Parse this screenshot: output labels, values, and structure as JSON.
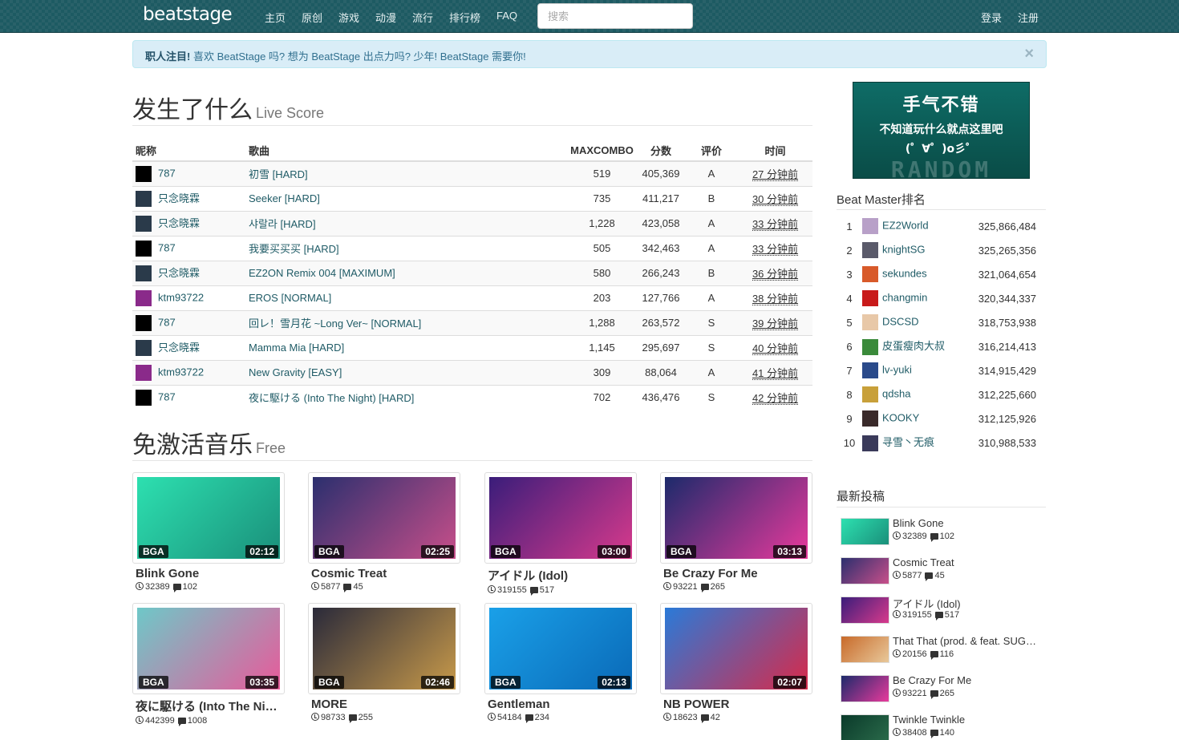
{
  "nav": {
    "brand": "beatstage",
    "links": [
      "主页",
      "原创",
      "游戏",
      "动漫",
      "流行",
      "排行榜",
      "FAQ"
    ],
    "search_placeholder": "搜索",
    "login": "登录",
    "register": "注册"
  },
  "alert": {
    "strong": "职人注目!",
    "text": "喜欢 BeatStage 吗? 想为 BeatStage 出点力吗? 少年! BeatStage 需要你!",
    "close": "×"
  },
  "live": {
    "title": "发生了什么",
    "subtitle": "Live Score",
    "headers": [
      "昵称",
      "歌曲",
      "MAXCOMBO",
      "分数",
      "评价",
      "时间"
    ],
    "rows": [
      {
        "user": "787",
        "song": "初雪 [HARD]",
        "combo": "519",
        "score": "405,369",
        "grade": "A",
        "time": "27 分钟前"
      },
      {
        "user": "只念晓霖",
        "song": "Seeker [HARD]",
        "combo": "735",
        "score": "411,217",
        "grade": "B",
        "time": "30 分钟前"
      },
      {
        "user": "只念晓霖",
        "song": "샤랄라 [HARD]",
        "combo": "1,228",
        "score": "423,058",
        "grade": "A",
        "time": "33 分钟前"
      },
      {
        "user": "787",
        "song": "我要买买买 [HARD]",
        "combo": "505",
        "score": "342,463",
        "grade": "A",
        "time": "33 分钟前"
      },
      {
        "user": "只念晓霖",
        "song": "EZ2ON Remix 004 [MAXIMUM]",
        "combo": "580",
        "score": "266,243",
        "grade": "B",
        "time": "36 分钟前"
      },
      {
        "user": "ktm93722",
        "song": "EROS [NORMAL]",
        "combo": "203",
        "score": "127,766",
        "grade": "A",
        "time": "38 分钟前"
      },
      {
        "user": "787",
        "song": "回レ！雪月花 ~Long Ver~ [NORMAL]",
        "combo": "1,288",
        "score": "263,572",
        "grade": "S",
        "time": "39 分钟前"
      },
      {
        "user": "只念晓霖",
        "song": "Mamma Mia [HARD]",
        "combo": "1,145",
        "score": "295,697",
        "grade": "S",
        "time": "40 分钟前"
      },
      {
        "user": "ktm93722",
        "song": "New Gravity [EASY]",
        "combo": "309",
        "score": "88,064",
        "grade": "A",
        "time": "41 分钟前"
      },
      {
        "user": "787",
        "song": "夜に駆ける (Into The Night) [HARD]",
        "combo": "702",
        "score": "436,476",
        "grade": "S",
        "time": "42 分钟前"
      }
    ]
  },
  "free": {
    "title": "免激活音乐",
    "subtitle": "Free",
    "cards": [
      {
        "title": "Blink Gone",
        "tag": "BGA",
        "duration": "02:12",
        "plays": "32389",
        "comments": "102",
        "colors": [
          "#2de0b0",
          "#1a8f7a"
        ]
      },
      {
        "title": "Cosmic Treat",
        "tag": "BGA",
        "duration": "02:25",
        "plays": "5877",
        "comments": "45",
        "colors": [
          "#2b2f6e",
          "#c84f8a"
        ]
      },
      {
        "title": "アイドル (Idol)",
        "tag": "BGA",
        "duration": "03:00",
        "plays": "319155",
        "comments": "517",
        "colors": [
          "#3a1d7a",
          "#d83a8c"
        ]
      },
      {
        "title": "Be Crazy For Me",
        "tag": "BGA",
        "duration": "03:13",
        "plays": "93221",
        "comments": "265",
        "colors": [
          "#1c2a6b",
          "#e83a9c"
        ]
      },
      {
        "title": "夜に駆ける (Into The Night)",
        "tag": "BGA",
        "duration": "03:35",
        "plays": "442399",
        "comments": "1008",
        "colors": [
          "#6ec8c8",
          "#e85a9a"
        ]
      },
      {
        "title": "MORE",
        "tag": "BGA",
        "duration": "02:46",
        "plays": "98733",
        "comments": "255",
        "colors": [
          "#2a2a3a",
          "#c89a4a"
        ]
      },
      {
        "title": "Gentleman",
        "tag": "BGA",
        "duration": "02:13",
        "plays": "54184",
        "comments": "234",
        "colors": [
          "#1aa0e8",
          "#0a6ab8"
        ]
      },
      {
        "title": "NB POWER",
        "tag": "",
        "duration": "02:07",
        "plays": "18623",
        "comments": "42",
        "colors": [
          "#2a7ad8",
          "#d82a4a"
        ]
      }
    ]
  },
  "banner": {
    "line1": "手气不错",
    "line2": "不知道玩什么就点这里吧",
    "line3": "(゜∀゜)o彡゜",
    "line4": "RANDOM"
  },
  "ranking": {
    "title": "Beat Master排名",
    "rows": [
      {
        "rank": "1",
        "name": "EZ2World",
        "score": "325,866,484",
        "color": "#b8a0c8"
      },
      {
        "rank": "2",
        "name": "knightSG",
        "score": "325,265,356",
        "color": "#5a5a6a"
      },
      {
        "rank": "3",
        "name": "sekundes",
        "score": "321,064,654",
        "color": "#d85a2a"
      },
      {
        "rank": "4",
        "name": "changmin",
        "score": "320,344,337",
        "color": "#c81a1a"
      },
      {
        "rank": "5",
        "name": "DSCSD",
        "score": "318,753,938",
        "color": "#e8c8a8"
      },
      {
        "rank": "6",
        "name": "皮蛋瘦肉大叔",
        "score": "316,214,413",
        "color": "#3a8a3a"
      },
      {
        "rank": "7",
        "name": "lv-yuki",
        "score": "314,915,429",
        "color": "#2a4a8a"
      },
      {
        "rank": "8",
        "name": "qdsha",
        "score": "312,225,660",
        "color": "#c8a03a"
      },
      {
        "rank": "9",
        "name": "KOOKY",
        "score": "312,125,926",
        "color": "#3a2a2a"
      },
      {
        "rank": "10",
        "name": "寻雪丶无痕",
        "score": "310,988,533",
        "color": "#3a3a5a"
      }
    ]
  },
  "latest": {
    "title": "最新投稿",
    "posts": [
      {
        "title": "Blink Gone",
        "plays": "32389",
        "comments": "102",
        "colors": [
          "#2de0b0",
          "#1a8f7a"
        ]
      },
      {
        "title": "Cosmic Treat",
        "plays": "5877",
        "comments": "45",
        "colors": [
          "#2b2f6e",
          "#c84f8a"
        ]
      },
      {
        "title": "アイドル (Idol)",
        "plays": "319155",
        "comments": "517",
        "colors": [
          "#3a1d7a",
          "#d83a8c"
        ]
      },
      {
        "title": "That That (prod. & feat. SUGA of BTS)",
        "plays": "20156",
        "comments": "116",
        "colors": [
          "#c86a2a",
          "#e8c89a"
        ]
      },
      {
        "title": "Be Crazy For Me",
        "plays": "93221",
        "comments": "265",
        "colors": [
          "#1c2a6b",
          "#e83a9c"
        ]
      },
      {
        "title": "Twinkle Twinkle",
        "plays": "38408",
        "comments": "140",
        "colors": [
          "#0a3a2a",
          "#2a6a4a"
        ]
      }
    ]
  },
  "avatar_colors": {
    "787": "#000000",
    "只念晓霖": "#2a3a4a",
    "ktm93722": "#8a2a8a"
  }
}
